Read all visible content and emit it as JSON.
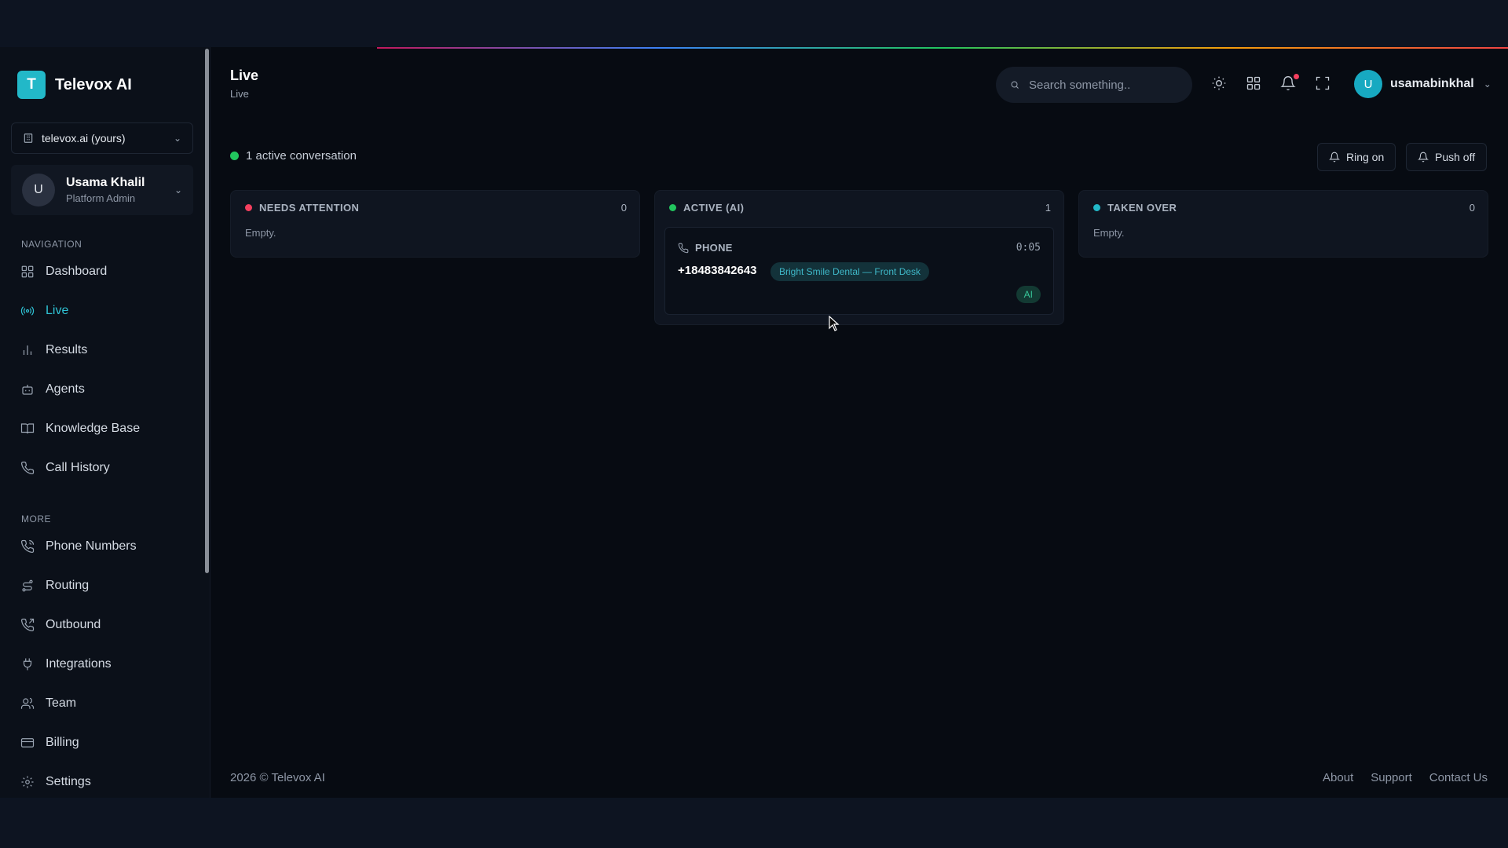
{
  "brand": {
    "logo_letter": "T",
    "name": "Televox AI"
  },
  "org_select": {
    "value": "televox.ai (yours)"
  },
  "user_card": {
    "initial": "U",
    "name": "Usama Khalil",
    "role": "Platform Admin"
  },
  "sidebar": {
    "nav_section": "NAVIGATION",
    "nav_items": [
      {
        "label": "Dashboard",
        "icon": "grid-icon"
      },
      {
        "label": "Live",
        "icon": "broadcast-icon",
        "active": true
      },
      {
        "label": "Results",
        "icon": "bar-chart-icon"
      },
      {
        "label": "Agents",
        "icon": "bot-icon"
      },
      {
        "label": "Knowledge Base",
        "icon": "book-icon"
      },
      {
        "label": "Call History",
        "icon": "phone-icon"
      }
    ],
    "more_section": "MORE",
    "more_items": [
      {
        "label": "Phone Numbers",
        "icon": "phone-call-icon"
      },
      {
        "label": "Routing",
        "icon": "route-icon"
      },
      {
        "label": "Outbound",
        "icon": "phone-outgoing-icon"
      },
      {
        "label": "Integrations",
        "icon": "plug-icon"
      },
      {
        "label": "Team",
        "icon": "users-icon"
      },
      {
        "label": "Billing",
        "icon": "credit-card-icon"
      },
      {
        "label": "Settings",
        "icon": "gear-icon"
      }
    ]
  },
  "header": {
    "title": "Live",
    "breadcrumb": "Live",
    "search_placeholder": "Search something..",
    "user_initial": "U",
    "username": "usamabinkhal"
  },
  "status": {
    "text": "1 active conversation",
    "color": "#22c55e"
  },
  "buttons": {
    "ring": "Ring on",
    "push": "Push off"
  },
  "columns": [
    {
      "title": "NEEDS ATTENTION",
      "count": "0",
      "color": "#f43f5e",
      "empty": "Empty."
    },
    {
      "title": "ACTIVE (AI)",
      "count": "1",
      "color": "#22c55e"
    },
    {
      "title": "TAKEN OVER",
      "count": "0",
      "color": "#22b8c8",
      "empty": "Empty."
    }
  ],
  "active_card": {
    "type": "PHONE",
    "time": "0:05",
    "phone": "+18483842643",
    "agent": "Bright Smile Dental — Front Desk",
    "badge": "AI"
  },
  "footer": {
    "copyright": "2026 © Televox AI",
    "links": [
      "About",
      "Support",
      "Contact Us"
    ]
  },
  "colors": {
    "accent": "#2fc2d4",
    "background": "#070b12"
  }
}
